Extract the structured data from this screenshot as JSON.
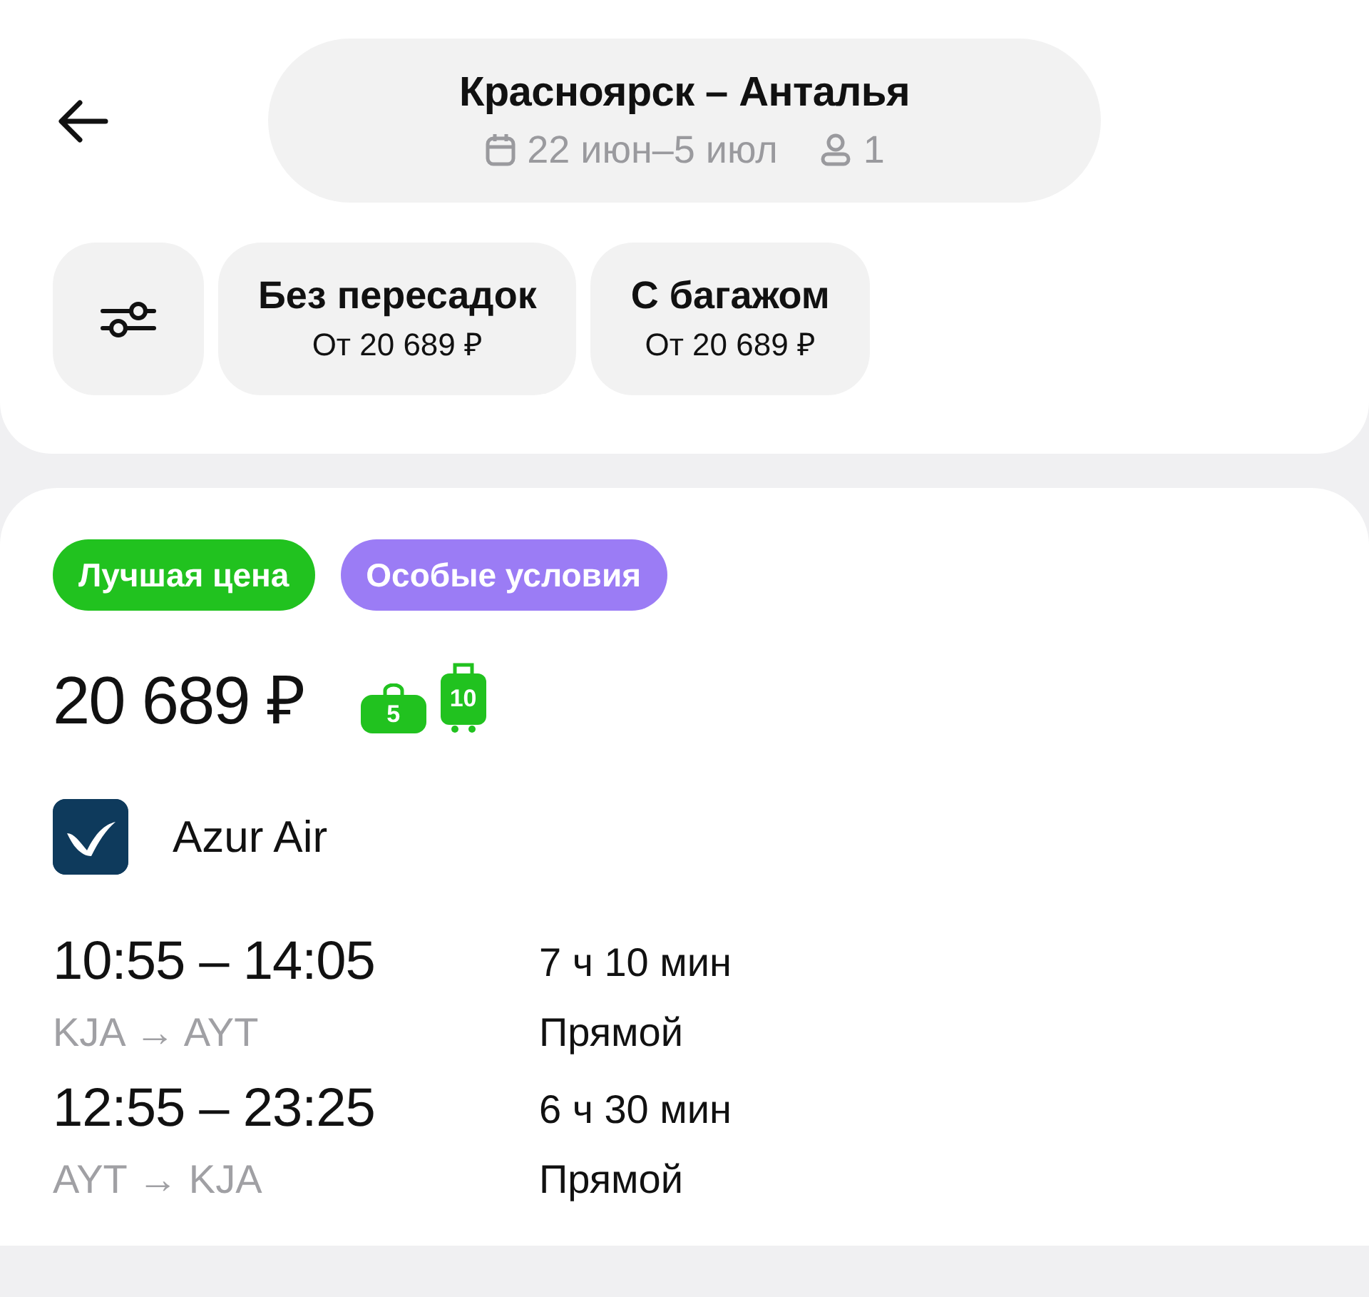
{
  "header": {
    "route": "Красноярск – Анталья",
    "dates": "22 июн–5 июл",
    "passengers": "1"
  },
  "filters": [
    {
      "title": "Без пересадок",
      "price": "От 20 689 ₽"
    },
    {
      "title": "С багажом",
      "price": "От 20 689 ₽"
    }
  ],
  "offer": {
    "tags": [
      {
        "label": "Лучшая цена",
        "color": "#21c21f"
      },
      {
        "label": "Особые условия",
        "color": "#9b7cf5"
      }
    ],
    "price": "20 689 ₽",
    "baggage": [
      {
        "kind": "handbag",
        "weight": "5"
      },
      {
        "kind": "suitcase",
        "weight": "10"
      }
    ],
    "airline": "Azur Air",
    "legs": [
      {
        "times": "10:55 – 14:05",
        "route": "KJA → AYT",
        "duration": "7 ч 10 мин",
        "stops": "Прямой"
      },
      {
        "times": "12:55 – 23:25",
        "route": "AYT → KJA",
        "duration": "6 ч 30 мин",
        "stops": "Прямой"
      }
    ]
  }
}
